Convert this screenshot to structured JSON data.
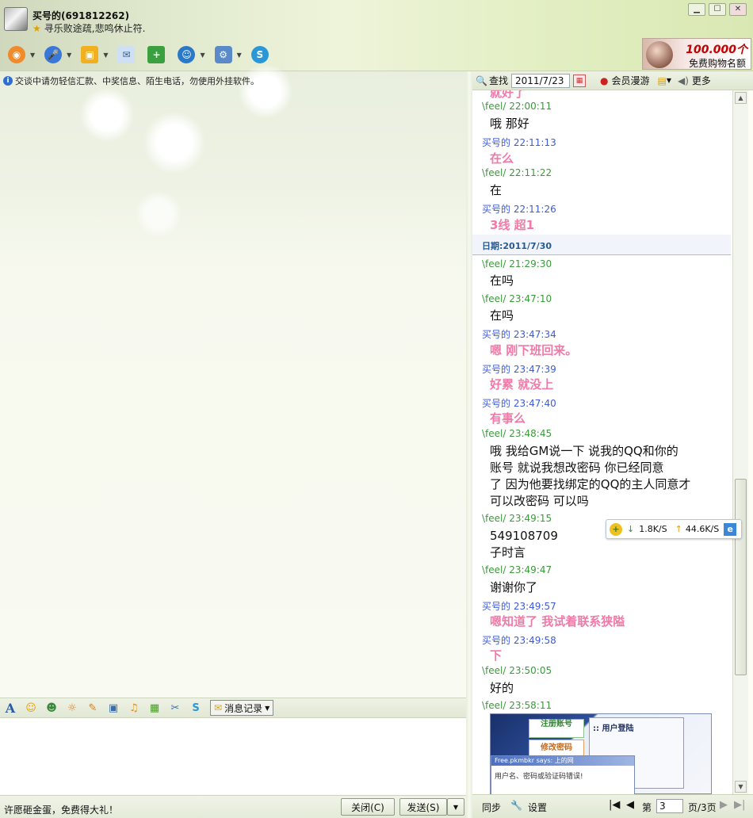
{
  "window": {
    "contact_name": "买号的(691812262)",
    "signature": "寻乐败途疏,悲鸣休止符."
  },
  "ad": {
    "amount": "100.000个",
    "text": "免费购物名额"
  },
  "notice": "交谈中请勿轻信汇款、中奖信息、陌生电话，勿使用外挂软件。",
  "history_toolbar": {
    "search_label": "查找",
    "date_value": "2011/7/23",
    "member_label": "会员漫游",
    "more_label": "更多"
  },
  "history": {
    "partial_top": "就好了",
    "date_separator": "日期:2011/7/30",
    "messages": [
      {
        "header": "\\feel/ 22:00:11",
        "body": "哦  那好"
      },
      {
        "header": "买号的 22:11:13",
        "body": "在么"
      },
      {
        "header": "\\feel/ 22:11:22",
        "body": "在"
      },
      {
        "header": "买号的 22:11:26",
        "body": "3线  超1"
      },
      {
        "header": "\\feel/ 21:29:30",
        "body": "在吗"
      },
      {
        "header": "\\feel/ 23:47:10",
        "body": "在吗"
      },
      {
        "header": "买号的 23:47:34",
        "body": "嗯  刚下班回来。"
      },
      {
        "header": "买号的 23:47:39",
        "body": "好累  就没上"
      },
      {
        "header": "买号的 23:47:40",
        "body": "有事么"
      },
      {
        "header": "\\feel/ 23:48:45",
        "body_lines": [
          "哦  我给GM说一下  说我的QQ和你的",
          "账号  就说我想改密码 你已经同意",
          "了  因为他要找绑定的QQ的主人同意才",
          "可以改密码     可以吗"
        ]
      },
      {
        "header": "\\feel/ 23:49:15",
        "body_lines": [
          "549108709",
          "子时言"
        ]
      },
      {
        "header": "\\feel/ 23:49:47",
        "body": "谢谢你了"
      },
      {
        "header": "买号的 23:49:57",
        "body": "嗯知道了  我试着联系狭隘"
      },
      {
        "header": "买号的 23:49:58",
        "body": "下"
      },
      {
        "header": "\\feel/ 23:50:05",
        "body": "好的"
      },
      {
        "header": "\\feel/ 23:58:11",
        "body": ""
      }
    ]
  },
  "thumbnail": {
    "box1": "注册账号",
    "box2": "修改密码",
    "panel_title": ":: 用户登陆",
    "dialog_title": "Free.pkmbkr says: 上的网",
    "dialog_text": "用户名、密码或验证码错误!"
  },
  "speed": {
    "down": "1.8K/S",
    "up": "44.6K/S"
  },
  "format_toolbar": {
    "history_label": "消息记录"
  },
  "bottom": {
    "promo": "许愿砸金蛋，免费得大礼！",
    "close_label": "关闭(C)",
    "send_label": "发送(S)"
  },
  "history_bottom": {
    "sync_label": "同步",
    "settings_label": "设置",
    "page_prefix": "第",
    "page_value": "3",
    "page_suffix": "页/3页"
  },
  "colors": {
    "me_header": "#3d5bd6",
    "feel_header": "#3a9a3a",
    "me_body": "#f07aa8"
  }
}
